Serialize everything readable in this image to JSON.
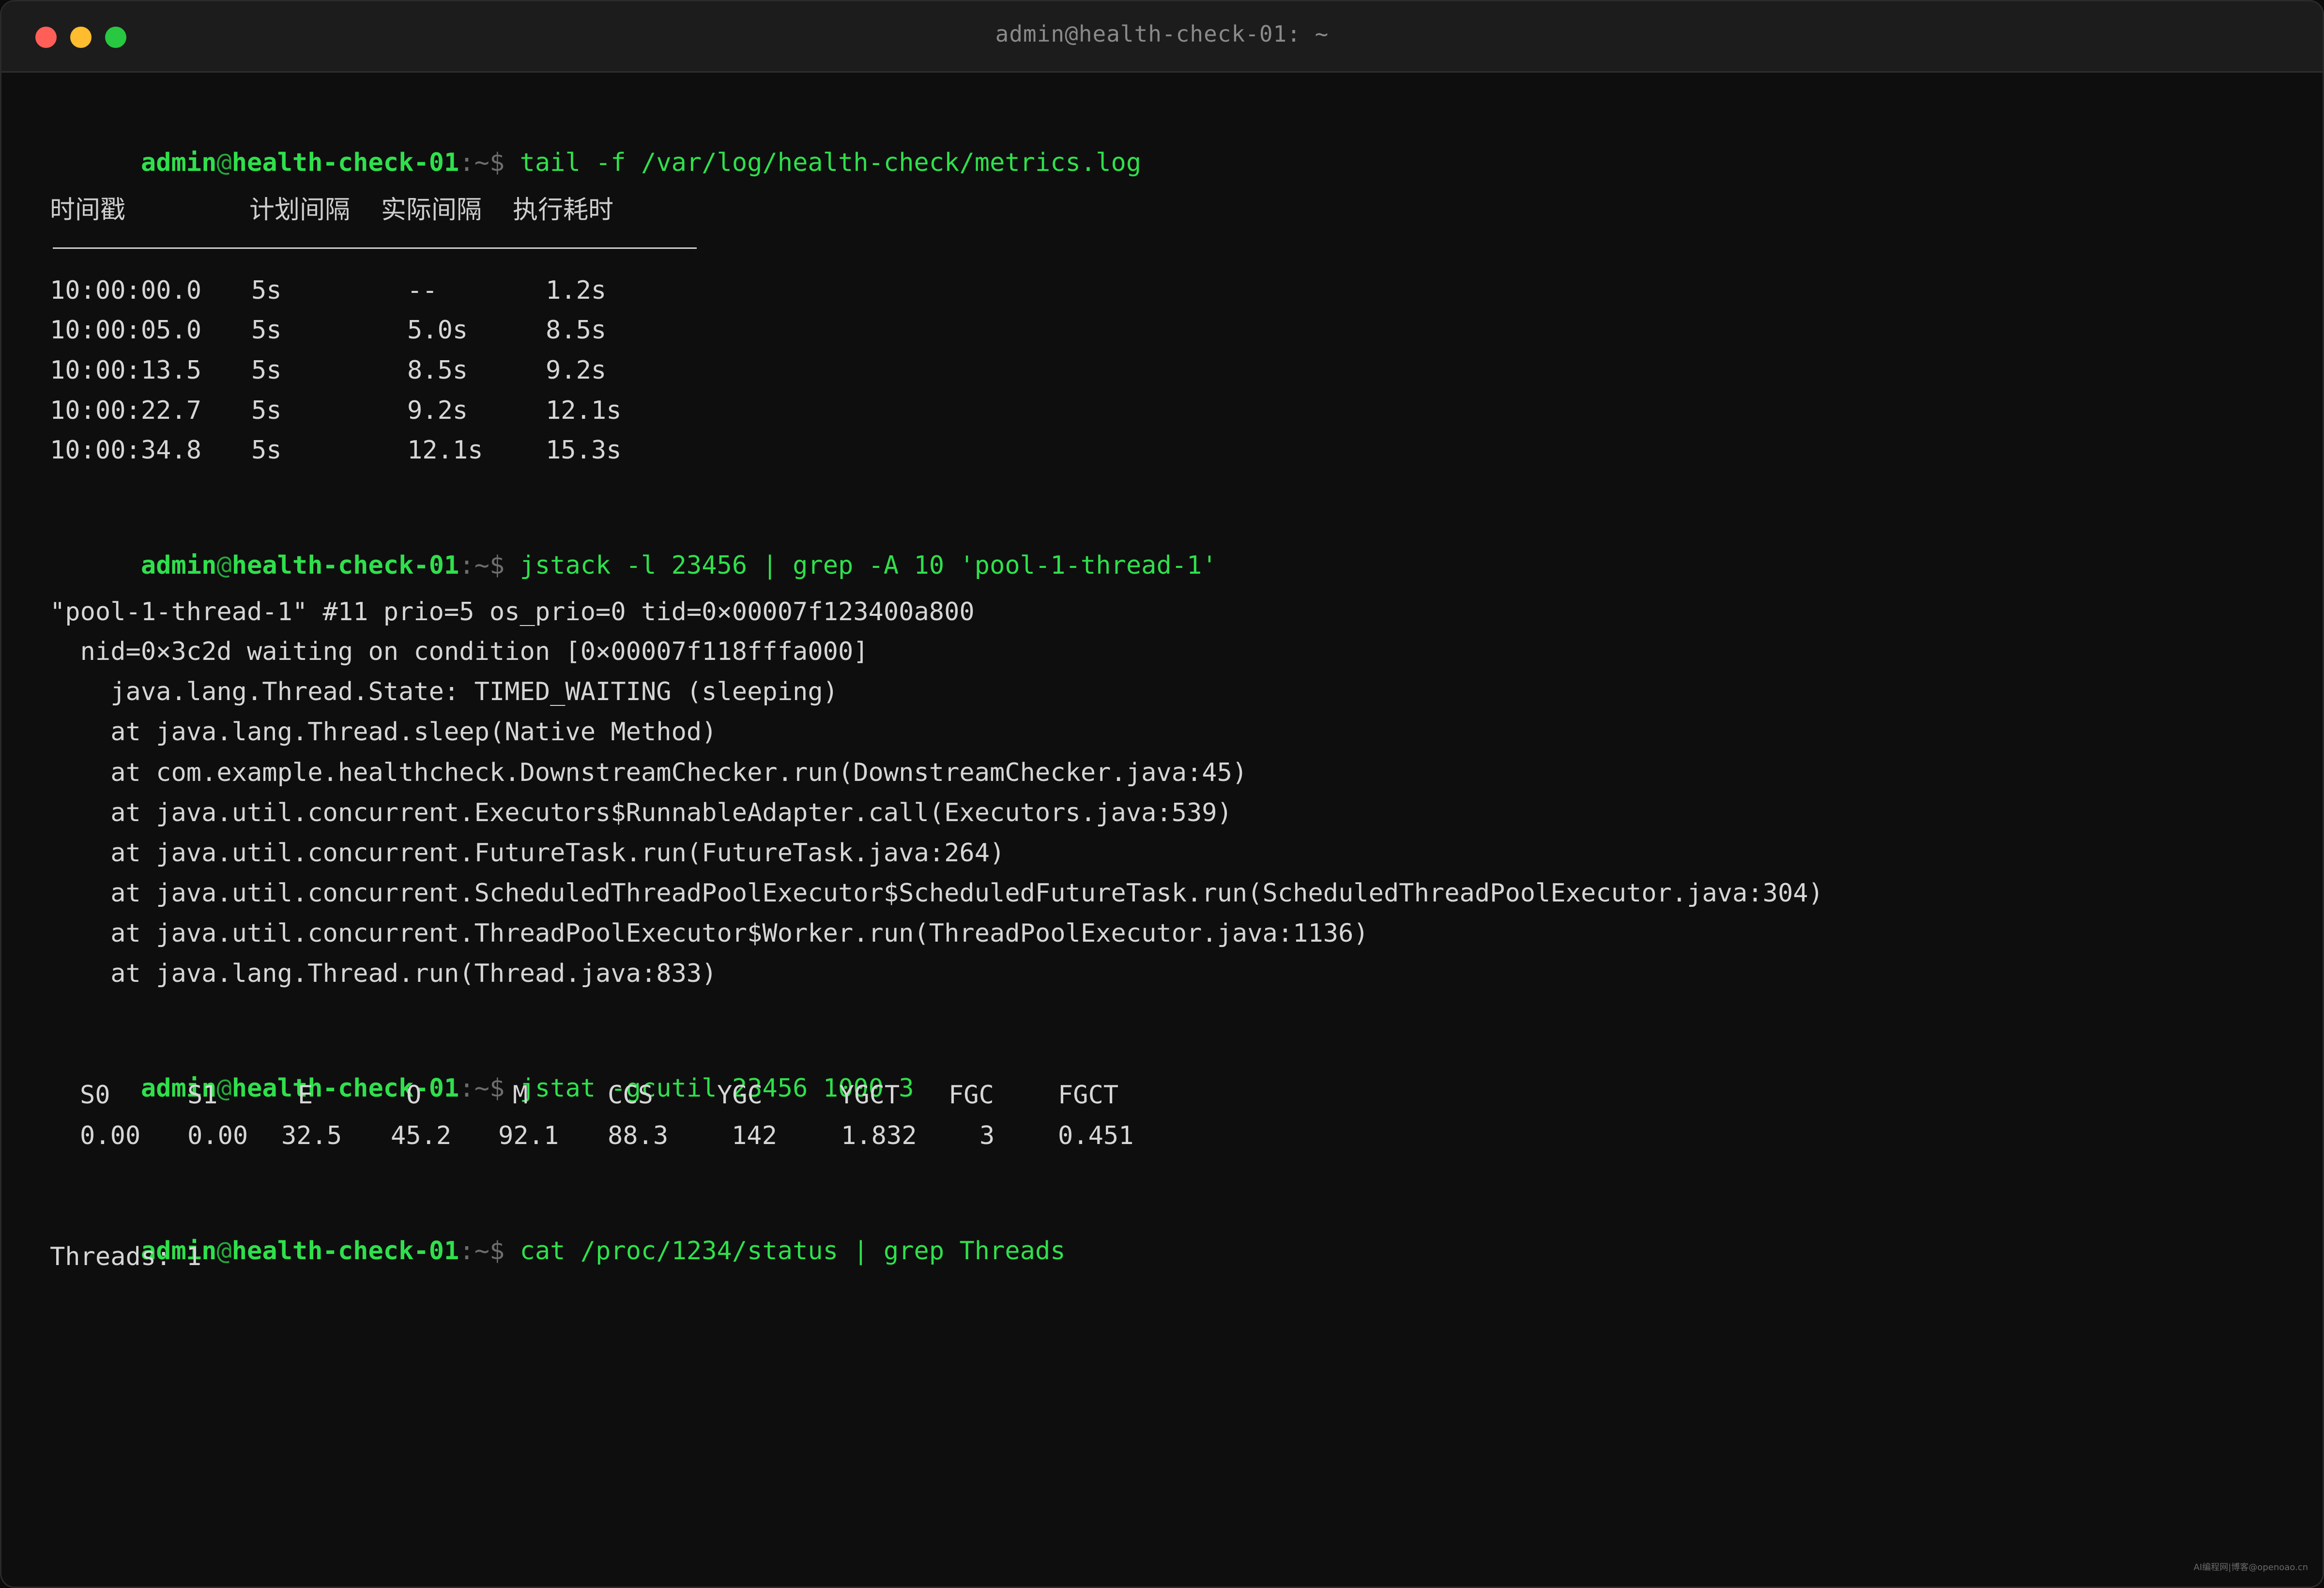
{
  "window": {
    "title": "admin@health-check-01: ~"
  },
  "prompt": {
    "user": "admin",
    "at": "@",
    "host": "health-check-01",
    "path": ":~",
    "dollar": "$"
  },
  "commands": [
    "tail -f /var/log/health-check/metrics.log",
    "jstack -l 23456 | grep -A 10 'pool-1-thread-1'",
    "jstat -gcutil 23456 1000 3",
    "cat /proc/1234/status | grep Threads"
  ],
  "metrics_table": {
    "headers": [
      "时间戳",
      "计划间隔",
      "实际间隔",
      "执行耗时"
    ],
    "rows": [
      [
        "10:00:00.0",
        "5s",
        "--",
        "1.2s"
      ],
      [
        "10:00:05.0",
        "5s",
        "5.0s",
        "8.5s"
      ],
      [
        "10:00:13.5",
        "5s",
        "8.5s",
        "9.2s"
      ],
      [
        "10:00:22.7",
        "5s",
        "9.2s",
        "12.1s"
      ],
      [
        "10:00:34.8",
        "5s",
        "12.1s",
        "15.3s"
      ]
    ]
  },
  "jstack_output": [
    "\"pool-1-thread-1\" #11 prio=5 os_prio=0 tid=0×00007f123400a800",
    "  nid=0×3c2d waiting on condition [0×00007f118fffa000]",
    "    java.lang.Thread.State: TIMED_WAITING (sleeping)",
    "    at java.lang.Thread.sleep(Native Method)",
    "    at com.example.healthcheck.DownstreamChecker.run(DownstreamChecker.java:45)",
    "    at java.util.concurrent.Executors$RunnableAdapter.call(Executors.java:539)",
    "    at java.util.concurrent.FutureTask.run(FutureTask.java:264)",
    "    at java.util.concurrent.ScheduledThreadPoolExecutor$ScheduledFutureTask.run(ScheduledThreadPoolExecutor.java:304)",
    "    at java.util.concurrent.ThreadPoolExecutor$Worker.run(ThreadPoolExecutor.java:1136)",
    "    at java.lang.Thread.run(Thread.java:833)"
  ],
  "jstat_table": {
    "headers": [
      "S0",
      "S1",
      "E",
      "O",
      "M",
      "CCS",
      "YGC",
      "YGCT",
      "FGC",
      "FGCT"
    ],
    "values": [
      "0.00",
      "0.00",
      "32.5",
      "45.2",
      "92.1",
      "88.3",
      "142",
      "1.832",
      "3",
      "0.451"
    ]
  },
  "threads_output": "Threads: 1",
  "watermark": "AI编程网|博客@openoao.cn"
}
